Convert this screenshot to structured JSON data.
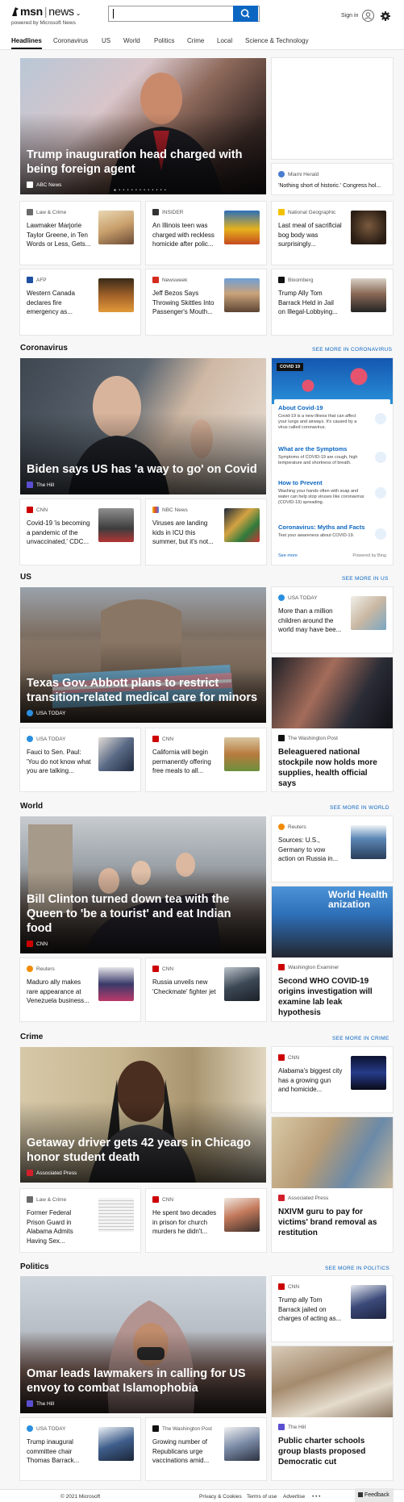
{
  "header": {
    "brand": "msn",
    "product": "news",
    "powered": "powered by Microsoft News",
    "search_placeholder": "",
    "signin": "Sign in"
  },
  "nav": {
    "tabs": [
      "Headlines",
      "Coronavirus",
      "US",
      "World",
      "Politics",
      "Crime",
      "Local",
      "Science & Technology"
    ]
  },
  "headlines": {
    "hero": {
      "title": "Trump inauguration head charged with being foreign agent",
      "source": "ABC News"
    },
    "side": {
      "source": "Miami Herald",
      "title": "'Nothing short of historic.' Congress hol..."
    },
    "cards": [
      {
        "source": "Law & Crime",
        "title": "Lawmaker Marjorie Taylor Greene, in Ten Words or Less, Gets..."
      },
      {
        "source": "INSIDER",
        "title": "An Illinois teen was charged with reckless homicide after polic..."
      },
      {
        "source": "National Geographic",
        "title": "Last meal of sacrificial bog body was surprisingly..."
      },
      {
        "source": "AFP",
        "title": "Western Canada declares fire emergency as..."
      },
      {
        "source": "Newsweek",
        "title": "Jeff Bezos Says Throwing Skittles Into Passenger's Mouth..."
      },
      {
        "source": "Bloomberg",
        "title": "Trump Ally Tom Barrack Held in Jail on Illegal-Lobbying..."
      }
    ]
  },
  "coronavirus": {
    "heading": "Coronavirus",
    "see_more": "SEE MORE IN CORONAVIRUS",
    "hero": {
      "title": "Biden says US has 'a way to go' on Covid",
      "source": "The Hill"
    },
    "cards": [
      {
        "source": "CNN",
        "title": "Covid-19 'is becoming a pandemic of the unvaccinated,' CDC..."
      },
      {
        "source": "NBC News",
        "title": "Viruses are landing kids in ICU this summer, but it's not..."
      }
    ],
    "covid": {
      "badge": "COVID 19",
      "items": [
        {
          "title": "About Covid-19",
          "text": "Covid-19 is a new illness that can affect your lungs and airways. It's caused by a virus called coronavirus."
        },
        {
          "title": "What are the Symptoms",
          "text": "Symptoms of COVID-19 are cough, high temperature and shortness of breath."
        },
        {
          "title": "How to Prevent",
          "text": "Washing your hands often with soap and water can help stop viruses like coronavirus (COVID-19) spreading."
        },
        {
          "title": "Coronavirus: Myths and Facts",
          "text": "Test your awareness about COVID-19."
        }
      ],
      "see_more": "See more",
      "powered": "Powered by Bing"
    }
  },
  "us": {
    "heading": "US",
    "see_more": "SEE MORE IN US",
    "hero": {
      "title": "Texas Gov. Abbott plans to restrict transition-related medical care for minors",
      "source": "USA TODAY"
    },
    "side": {
      "source": "USA TODAY",
      "title": "More than a million children around the world may have bee..."
    },
    "tall": {
      "source": "The Washington Post",
      "title": "Beleaguered national stockpile now holds more supplies, health official says"
    },
    "cards": [
      {
        "source": "USA TODAY",
        "title": "Fauci to Sen. Paul: 'You do not know what you are talking..."
      },
      {
        "source": "CNN",
        "title": "California will begin permanently offering free meals to all..."
      }
    ]
  },
  "world": {
    "heading": "World",
    "see_more": "SEE MORE IN WORLD",
    "hero": {
      "title": "Bill Clinton turned down tea with the Queen to 'be a tourist' and eat Indian food",
      "source": "CNN"
    },
    "side": {
      "source": "Reuters",
      "title": "Sources: U.S., Germany to vow action on Russia in..."
    },
    "tall": {
      "source": "Washington Examiner",
      "title": "Second WHO COVID-19 origins investigation will examine lab leak hypothesis"
    },
    "cards": [
      {
        "source": "Reuters",
        "title": "Maduro ally makes rare appearance at Venezuela business..."
      },
      {
        "source": "CNN",
        "title": "Russia unveils new 'Checkmate' fighter jet"
      }
    ]
  },
  "crime": {
    "heading": "Crime",
    "see_more": "SEE MORE IN CRIME",
    "hero": {
      "title": "Getaway driver gets 42 years in Chicago honor student death",
      "source": "Associated Press"
    },
    "side": {
      "source": "CNN",
      "title": "Alabama's biggest city has a growing gun and homicide..."
    },
    "tall": {
      "source": "Associated Press",
      "title": "NXIVM guru to pay for victims' brand removal as restitution"
    },
    "cards": [
      {
        "source": "Law & Crime",
        "title": "Former Federal Prison Guard in Alabama Admits Having Sex..."
      },
      {
        "source": "CNN",
        "title": "He spent two decades in prison for church murders he didn't..."
      }
    ]
  },
  "politics": {
    "heading": "Politics",
    "see_more": "SEE MORE IN POLITICS",
    "hero": {
      "title": "Omar leads lawmakers in calling for US envoy to combat Islamophobia",
      "source": "The Hill"
    },
    "side": {
      "source": "CNN",
      "title": "Trump ally Tom Barrack jailed on charges of acting as..."
    },
    "tall": {
      "source": "The Hill",
      "title": "Public charter schools group blasts proposed Democratic cut"
    },
    "cards": [
      {
        "source": "USA TODAY",
        "title": "Trump inaugural committee chair Thomas Barrack..."
      },
      {
        "source": "The Washington Post",
        "title": "Growing number of Republicans urge vaccinations amid..."
      }
    ]
  },
  "footer": {
    "copyright": "© 2021 Microsoft",
    "links": [
      "Privacy & Cookies",
      "Terms of use",
      "Advertise"
    ],
    "more": "• • •",
    "feedback": "Feedback"
  }
}
